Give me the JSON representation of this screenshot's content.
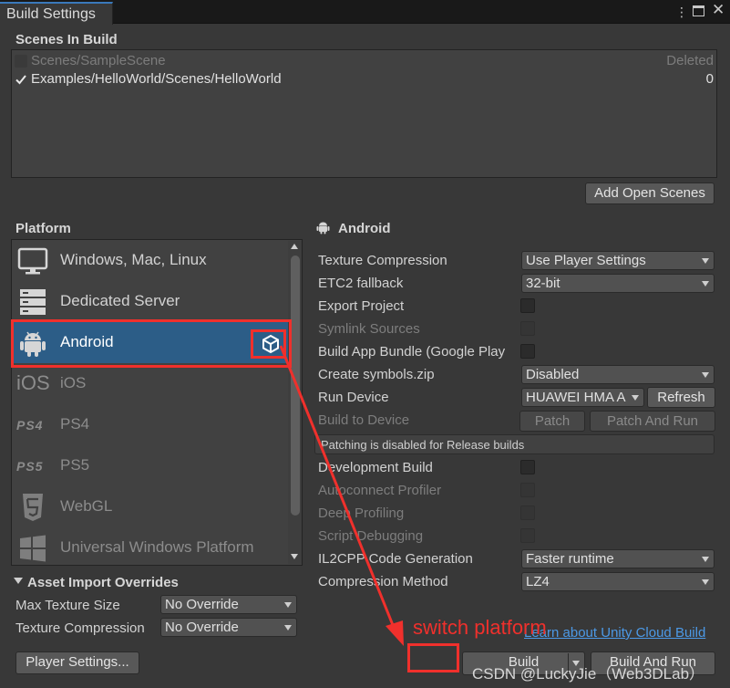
{
  "window": {
    "tab_title": "Build Settings",
    "menu_icon": "kebab-menu-icon",
    "maximize_icon": "maximize-icon",
    "close_icon": "close-icon"
  },
  "scenes": {
    "title": "Scenes In Build",
    "items": [
      {
        "name": "Scenes/SampleScene",
        "index": "Deleted",
        "checked": false
      },
      {
        "name": "Examples/HelloWorld/Scenes/HelloWorld",
        "index": "0",
        "checked": true
      }
    ],
    "add_open_scenes": "Add Open Scenes"
  },
  "platform": {
    "title": "Platform",
    "items": [
      {
        "label": "Windows, Mac, Linux",
        "icon": "monitor-icon"
      },
      {
        "label": "Dedicated Server",
        "icon": "server-icon"
      },
      {
        "label": "Android",
        "icon": "android-icon",
        "selected": true,
        "active_icon": "unity-logo-icon"
      },
      {
        "label": "iOS",
        "icon": "ios-icon",
        "icon_text": "iOS"
      },
      {
        "label": "PS4",
        "icon": "ps4-icon",
        "icon_text": "PS4"
      },
      {
        "label": "PS5",
        "icon": "ps5-icon",
        "icon_text": "PS5"
      },
      {
        "label": "WebGL",
        "icon": "html5-icon"
      },
      {
        "label": "Universal Windows Platform",
        "icon": "windows-icon"
      }
    ]
  },
  "android": {
    "header": "Android",
    "texture_compression": {
      "label": "Texture Compression",
      "value": "Use Player Settings"
    },
    "etc2_fallback": {
      "label": "ETC2 fallback",
      "value": "32-bit"
    },
    "export_project": {
      "label": "Export Project"
    },
    "symlink_sources": {
      "label": "Symlink Sources"
    },
    "build_app_bundle": {
      "label": "Build App Bundle (Google Play"
    },
    "create_symbols": {
      "label": "Create symbols.zip",
      "value": "Disabled"
    },
    "run_device": {
      "label": "Run Device",
      "value": "HUAWEI HMA A",
      "refresh": "Refresh"
    },
    "build_to_device": {
      "label": "Build to Device",
      "patch": "Patch",
      "patch_and_run": "Patch And Run"
    },
    "patch_info": "Patching is disabled for Release builds",
    "development_build": {
      "label": "Development Build"
    },
    "autoconnect_profiler": {
      "label": "Autoconnect Profiler"
    },
    "deep_profiling": {
      "label": "Deep Profiling"
    },
    "script_debugging": {
      "label": "Script Debugging"
    },
    "il2cpp": {
      "label": "IL2CPP Code Generation",
      "value": "Faster runtime"
    },
    "compression": {
      "label": "Compression Method",
      "value": "LZ4"
    }
  },
  "asset_overrides": {
    "title": "Asset Import Overrides",
    "max_texture_size": {
      "label": "Max Texture Size",
      "value": "No Override"
    },
    "texture_compression": {
      "label": "Texture Compression",
      "value": "No Override"
    }
  },
  "footer": {
    "player_settings": "Player Settings...",
    "cloud_link": "Learn about Unity Cloud Build",
    "build": "Build",
    "build_and_run": "Build And Run"
  },
  "annotation": {
    "text": "switch platform",
    "color": "#f0302c"
  },
  "watermark": "CSDN @LuckyJie（Web3DLab）"
}
